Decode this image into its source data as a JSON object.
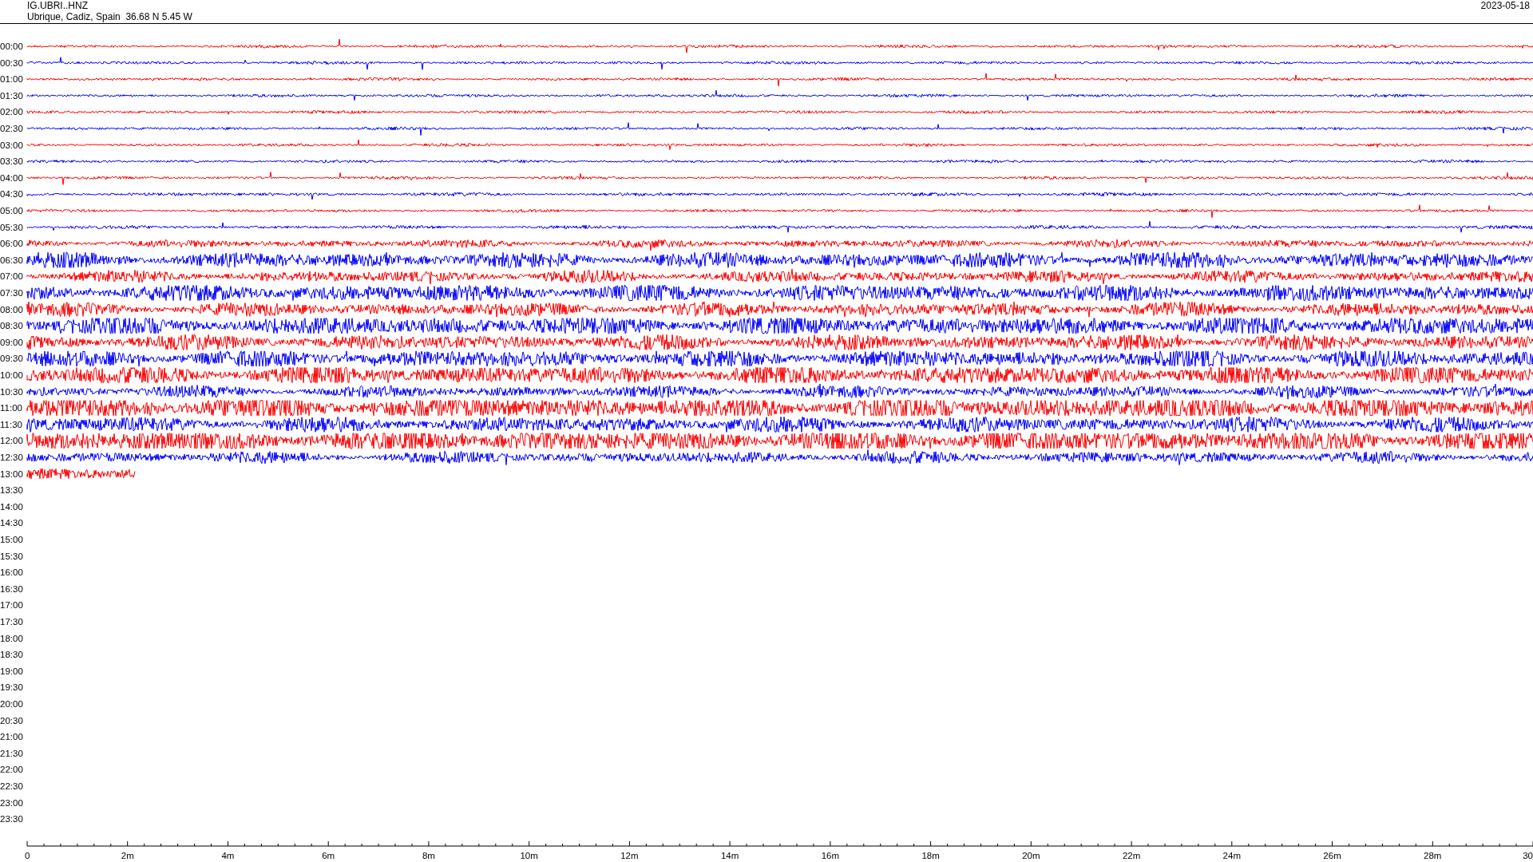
{
  "header": {
    "station": "IG.UBRI..HNZ",
    "location": "Ubrique, Cadiz, Spain  36.68 N 5.45 W",
    "date": "2023-05-18"
  },
  "rows": [
    {
      "label": "00:00",
      "color": "#ff0000",
      "level": 1
    },
    {
      "label": "00:30",
      "color": "#0000ff",
      "level": 1
    },
    {
      "label": "01:00",
      "color": "#ff0000",
      "level": 1
    },
    {
      "label": "01:30",
      "color": "#0000ff",
      "level": 1
    },
    {
      "label": "02:00",
      "color": "#ff0000",
      "level": 1
    },
    {
      "label": "02:30",
      "color": "#0000ff",
      "level": 1
    },
    {
      "label": "03:00",
      "color": "#ff0000",
      "level": 1
    },
    {
      "label": "03:30",
      "color": "#0000ff",
      "level": 1
    },
    {
      "label": "04:00",
      "color": "#ff0000",
      "level": 1
    },
    {
      "label": "04:30",
      "color": "#0000ff",
      "level": 1
    },
    {
      "label": "05:00",
      "color": "#ff0000",
      "level": 1
    },
    {
      "label": "05:30",
      "color": "#0000ff",
      "level": 1
    },
    {
      "label": "06:00",
      "color": "#ff0000",
      "level": 1
    },
    {
      "label": "06:30",
      "color": "#0000ff",
      "level": 1
    },
    {
      "label": "07:00",
      "color": "#ff0000",
      "level": 1
    },
    {
      "label": "07:30",
      "color": "#0000ff",
      "level": 1
    },
    {
      "label": "08:00",
      "color": "#ff0000",
      "level": 1
    },
    {
      "label": "08:30",
      "color": "#0000ff",
      "level": 1
    },
    {
      "label": "09:00",
      "color": "#ff0000",
      "level": 1
    },
    {
      "label": "09:30",
      "color": "#0000ff",
      "level": 1
    },
    {
      "label": "10:00",
      "color": "#ff0000",
      "level": 1
    },
    {
      "label": "10:30",
      "color": "#0000ff",
      "level": 1
    },
    {
      "label": "11:00",
      "color": "#ff0000",
      "level": 1
    },
    {
      "label": "11:30",
      "color": "#0000ff",
      "level": 1
    },
    {
      "label": "12:00",
      "color": "#ff0000",
      "level": 1
    },
    {
      "label": "12:30",
      "color": "#0000ff",
      "level": 1
    },
    {
      "label": "13:00",
      "color": "#ff0000",
      "level": 0.072
    },
    {
      "label": "13:30"
    },
    {
      "label": "14:00"
    },
    {
      "label": "14:30"
    },
    {
      "label": "15:00"
    },
    {
      "label": "15:30"
    },
    {
      "label": "16:00"
    },
    {
      "label": "16:30"
    },
    {
      "label": "17:00"
    },
    {
      "label": "17:30"
    },
    {
      "label": "18:00"
    },
    {
      "label": "18:30"
    },
    {
      "label": "19:00"
    },
    {
      "label": "19:30"
    },
    {
      "label": "20:00"
    },
    {
      "label": "20:30"
    },
    {
      "label": "21:00"
    },
    {
      "label": "21:30"
    },
    {
      "label": "22:00"
    },
    {
      "label": "22:30"
    },
    {
      "label": "23:00"
    },
    {
      "label": "23:30"
    }
  ],
  "x_axis": {
    "labels": [
      "0",
      "2m",
      "4m",
      "6m",
      "8m",
      "10m",
      "12m",
      "14m",
      "16m",
      "18m",
      "20m",
      "22m",
      "24m",
      "26m",
      "28m",
      "30"
    ]
  }
}
